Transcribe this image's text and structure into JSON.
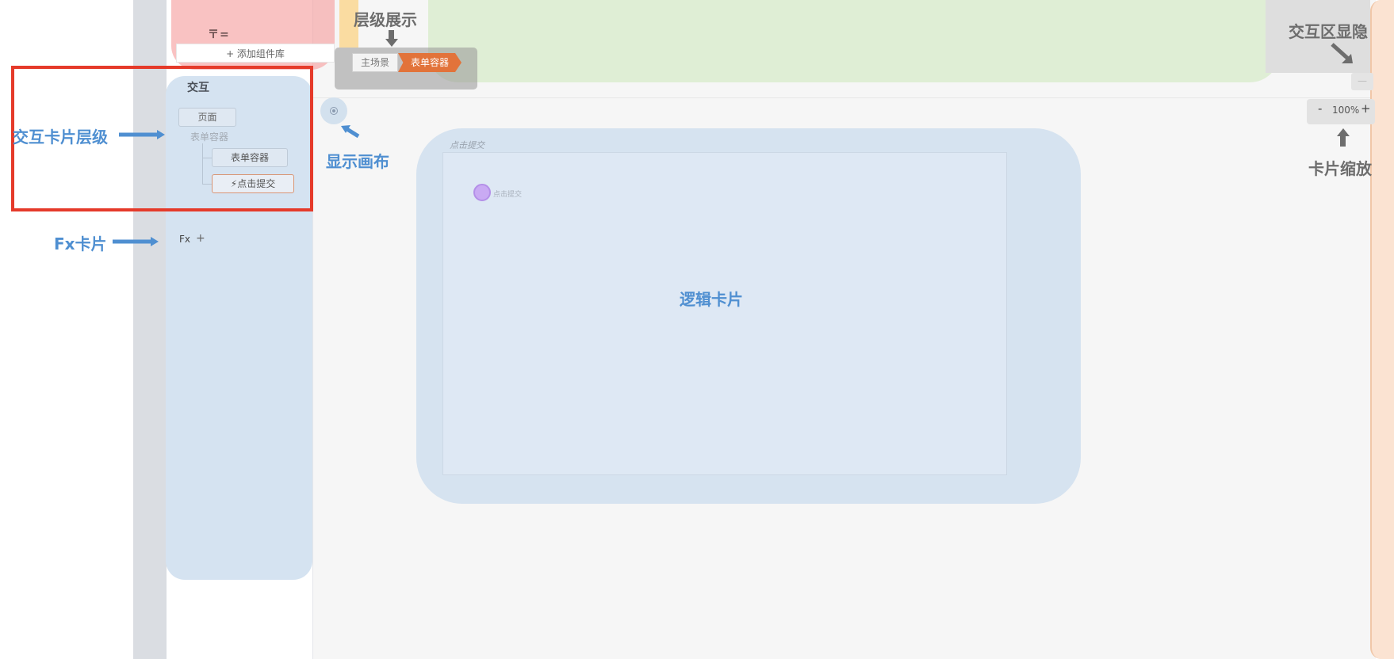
{
  "side_panel": {
    "component_library_glyph": "〒=",
    "add_library_button": "+ 添加组件库"
  },
  "breadcrumb": {
    "items": [
      "主场景",
      "表单容器"
    ]
  },
  "interaction_panel": {
    "title": "交互",
    "tree": {
      "page": "页面",
      "form_container_label": "表单容器",
      "form_container": "表单容器",
      "submit": "⚡点击提交"
    },
    "fx": {
      "label": "Fx",
      "add": "+"
    }
  },
  "logic_card": {
    "caption": "点击提交",
    "event_label": "点击提交"
  },
  "zoom": {
    "minus": "-",
    "value": "100%",
    "plus": "+"
  },
  "minimize": "—",
  "annotations": {
    "interaction_card_levels": "交互卡片层级",
    "fx_card": "Fx卡片",
    "show_canvas": "显示画布",
    "logic_card": "逻辑卡片",
    "hierarchy_display": "层级展示",
    "interaction_toggle": "交互区显隐",
    "card_zoom": "卡片缩放"
  },
  "colors": {
    "annotation_blue": "#4f8fd1",
    "annotation_gray": "#6d6d6d",
    "highlight_red": "#e53a2a",
    "breadcrumb_active": "#e2733a"
  }
}
